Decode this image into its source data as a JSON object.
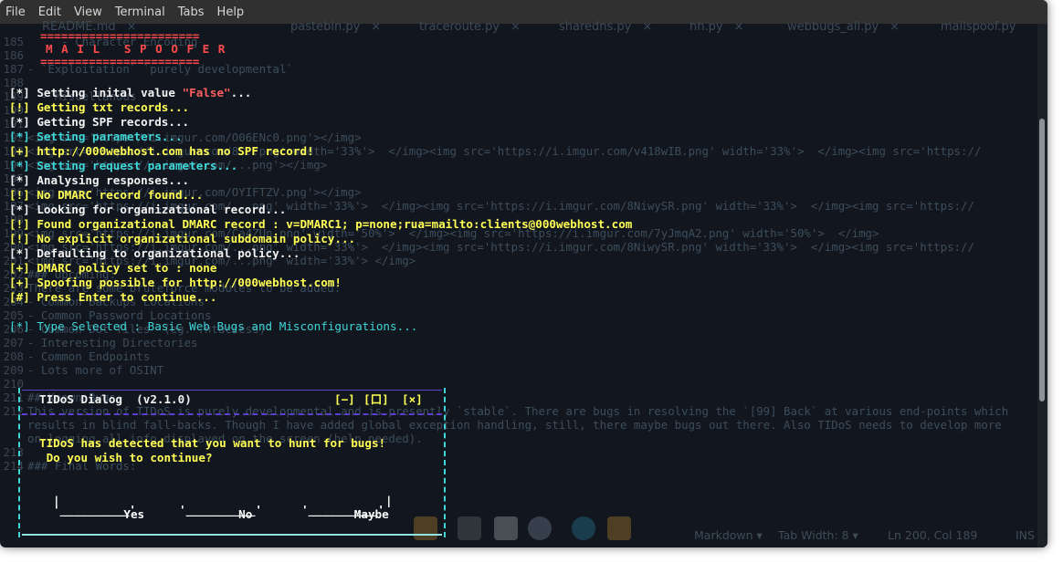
{
  "menu": [
    "File",
    "Edit",
    "View",
    "Terminal",
    "Tabs",
    "Help"
  ],
  "background_editor": {
    "tabs": [
      "README.md",
      "pastebin.py",
      "traceroute.py",
      "sharedns.py",
      "hh.py",
      "webbugs_all.py",
      "mailspoof.py"
    ],
    "tab_close": "×",
    "lines": [
      {
        "num": "185",
        "text": "     - Character Encoding"
      },
      {
        "num": "186",
        "text": ""
      },
      {
        "num": "187",
        "text": "- `Exploitation` `purely developmental`"
      },
      {
        "num": "188",
        "text": ""
      },
      {
        "num": "189",
        "text": "  - Miscellanous"
      },
      {
        "num": "190",
        "text": ""
      },
      {
        "num": "191",
        "text": ""
      },
      {
        "num": "192",
        "text": "<img src='https://i.imgur.com/O06ENc0.png'></img>"
      },
      {
        "num": "193",
        "text": "<img src='https://i.imgur.com/8...png' width='33%'>  </img><img src='https://i.imgur.com/v418wIB.png' width='33%'>  </img><img src='https://"
      },
      {
        "num": "194",
        "text": "<img src='https://i.imgur.com/...png'></img>"
      },
      {
        "num": "195",
        "text": ""
      },
      {
        "num": "196",
        "text": "<img src='https://i.imgur.com/OYIFTZV.png'></img>"
      },
      {
        "num": "197",
        "text": "<img src='https://i.imgur.com/...png' width='33%'>  </img><img src='https://i.imgur.com/8NiwySR.png' width='33%'>  </img><img src='https://"
      },
      {
        "num": "198",
        "text": ""
      },
      {
        "num": "199",
        "text": "<img src='https://i.imgur.com/Ca4ZUn.png' width='50%'>  </img><img src='https://i.imgur.com/7yJmqA2.png' width='50%'>  </img>"
      },
      {
        "num": "200",
        "text": "<img src='https://i.imgur.com/...png' width='33%'>  </img><img src='https://i.imgur.com/8NiwySR.png' width='33%'>  </img><img src='https://"
      },
      {
        "num": "201",
        "text": "<img src='https://i.imgur.com/...png' width='33%'> </img>"
      },
      {
        "num": "202",
        "text": "### Upcoming:"
      },
      {
        "num": "203",
        "text": "There are some bruteforce modules to be added:"
      },
      {
        "num": "204",
        "text": "- Common Backups Locations"
      },
      {
        "num": "205",
        "text": "- Common Password Locations"
      },
      {
        "num": "206",
        "text": "- Common Dot files `(eg. .htaccess)`"
      },
      {
        "num": "207",
        "text": "- Interesting Directories"
      },
      {
        "num": "208",
        "text": "- Common Endpoints"
      },
      {
        "num": "209",
        "text": "- Lots more of OSINT"
      },
      {
        "num": "210",
        "text": ""
      },
      {
        "num": "211",
        "text": "## Known Bugs:"
      },
      {
        "num": "212",
        "text": "This version of TIDoS is purely developmental and is presently `stable`. There are bugs in resolving the `[99] Back` at various end-points which"
      },
      {
        "num": "",
        "text": "results in blind fall-backs. Though I have added global exception handling, still, there maybe bugs out there. Also TIDoS needs to develop more"
      },
      {
        "num": "",
        "text": "on logging all info displayed on the screen (help needed)."
      },
      {
        "num": "213",
        "text": ""
      },
      {
        "num": "214",
        "text": "### Final Words:"
      }
    ],
    "status": {
      "mode": "Markdown ▾",
      "tabwidth": "Tab Width: 8 ▾",
      "position": "Ln 200, Col 189",
      "ins": "INS"
    }
  },
  "banner": {
    "rule_top": "=======================",
    "title": "M A I L   S P O O F E R",
    "rule_bottom": "======================="
  },
  "terminal_lines": [
    {
      "prefix": "[*]",
      "text": " Setting inital value ",
      "extra": "\"False\"",
      "tail": "...",
      "color": "w"
    },
    {
      "prefix": "[!]",
      "text": " Getting txt records...",
      "color": "y"
    },
    {
      "prefix": "[*]",
      "text": " Getting SPF records...",
      "color": "w"
    },
    {
      "prefix": "[*]",
      "text": " Setting parameters...",
      "color": "c"
    },
    {
      "prefix": "[+]",
      "text": " http://000webhost.com has no SPF record!",
      "color": "y"
    },
    {
      "prefix": "[*]",
      "text": " Setting request parameters...",
      "color": "c"
    },
    {
      "prefix": "[*]",
      "text": " Analysing responses...",
      "color": "w"
    },
    {
      "prefix": "[!]",
      "text": " No DMARC record found...",
      "color": "y"
    },
    {
      "prefix": "[*]",
      "text": " Looking for organizational record...",
      "color": "w"
    },
    {
      "prefix": "[!]",
      "text": " Found organizational DMARC record : v=DMARC1; p=none;rua=mailto:clients@000webhost.com",
      "color": "y"
    },
    {
      "prefix": "[!]",
      "text": " No explicit organizational subdomain policy...",
      "color": "y"
    },
    {
      "prefix": "[*]",
      "text": " Defaulting to organizational policy...",
      "color": "w"
    },
    {
      "prefix": "[+]",
      "text": " DMARC policy set to : none",
      "color": "y"
    },
    {
      "prefix": "[+]",
      "text": " Spoofing possible for http://000webhost.com!",
      "color": "y"
    },
    {
      "prefix": "[#]",
      "text": " Press Enter to continue...",
      "color": "y"
    }
  ],
  "type_selected": "[*] Type Selected : Basic Web Bugs and Misconfigurations...",
  "dialog": {
    "title": "TIDoS Dialog  (v2.1.0)",
    "controls": {
      "minimize": "[−]",
      "maximize": "[口]",
      "close": "[×]"
    },
    "message_line1": "TIDoS has detected that you want to hunt for bugs!",
    "message_line2": " Do you wish to continue?",
    "buttons": [
      "Yes",
      "No",
      "Maybe"
    ]
  }
}
